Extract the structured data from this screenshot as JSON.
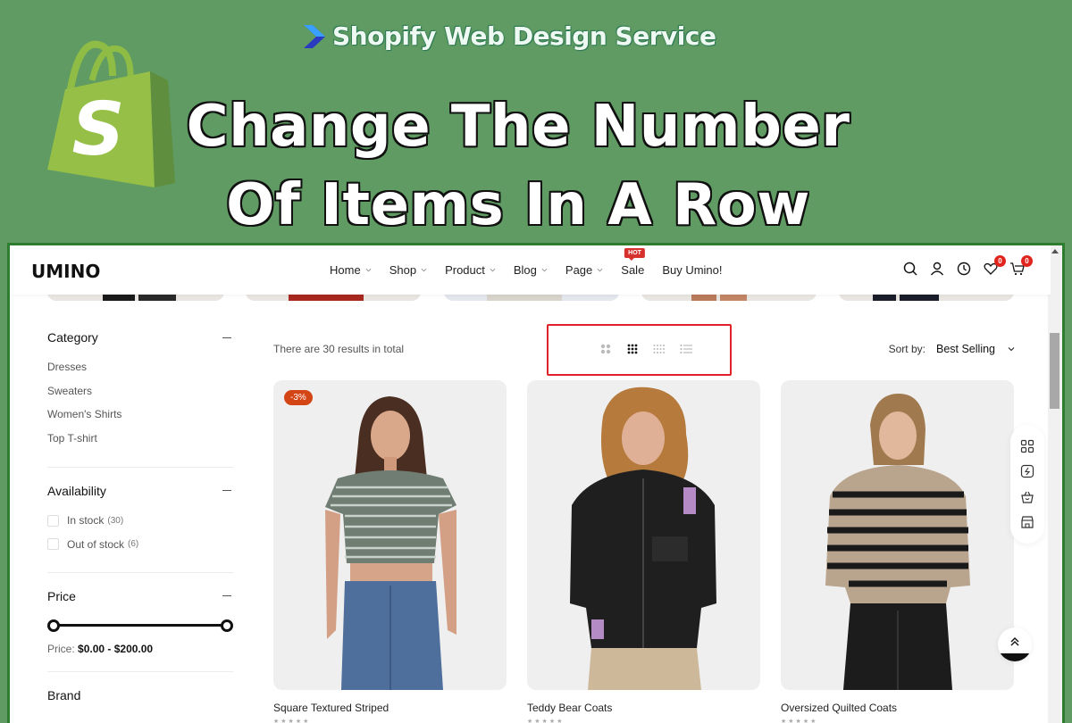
{
  "banner": {
    "service_label": "Shopify Web Design Service",
    "headline_line1": "Change The Number",
    "headline_line2": "Of Items In A Row",
    "bag_letter": "S",
    "colors": {
      "background": "#5f9b62",
      "bag_light": "#95bf47",
      "bag_dark": "#5e8e3e"
    }
  },
  "store": {
    "logo": "UMINO",
    "nav": [
      {
        "label": "Home",
        "has_dropdown": true
      },
      {
        "label": "Shop",
        "has_dropdown": true
      },
      {
        "label": "Product",
        "has_dropdown": true
      },
      {
        "label": "Blog",
        "has_dropdown": true
      },
      {
        "label": "Page",
        "has_dropdown": true
      },
      {
        "label": "Sale",
        "has_dropdown": false,
        "badge": "HOT"
      },
      {
        "label": "Buy Umino!",
        "has_dropdown": false
      }
    ],
    "header_icons": [
      {
        "name": "search-icon"
      },
      {
        "name": "account-icon"
      },
      {
        "name": "recently-viewed-icon"
      },
      {
        "name": "wishlist-icon",
        "count": "0"
      },
      {
        "name": "cart-icon",
        "count": "0"
      }
    ]
  },
  "sidebar": {
    "category": {
      "title": "Category",
      "items": [
        "Dresses",
        "Sweaters",
        "Women's Shirts",
        "Top T-shirt"
      ]
    },
    "availability": {
      "title": "Availability",
      "options": [
        {
          "label": "In stock",
          "count": "(30)",
          "checked": false
        },
        {
          "label": "Out of stock",
          "count": "(6)",
          "checked": false
        }
      ]
    },
    "price": {
      "title": "Price",
      "label": "Price:",
      "range_text": "$0.00 - $200.00",
      "min": 0,
      "max": 200
    },
    "brand": {
      "title": "Brand"
    }
  },
  "toolbar": {
    "result_text": "There are 30 results in total",
    "views": [
      {
        "name": "grid-2-icon",
        "active": false
      },
      {
        "name": "grid-3-icon",
        "active": true
      },
      {
        "name": "grid-4-icon",
        "active": false
      },
      {
        "name": "list-view-icon",
        "active": false
      }
    ],
    "sort_label": "Sort by:",
    "sort_value": "Best Selling",
    "highlight_color": "#e0232b"
  },
  "products": [
    {
      "title": "Square Textured Striped",
      "badge": "-3%"
    },
    {
      "title": "Teddy Bear Coats",
      "badge": null
    },
    {
      "title": "Oversized Quilted Coats",
      "badge": null
    }
  ],
  "rating_stars": "★★★★★",
  "floating_tools": [
    "layout-icon",
    "compare-icon",
    "basket-icon",
    "store-icon"
  ]
}
